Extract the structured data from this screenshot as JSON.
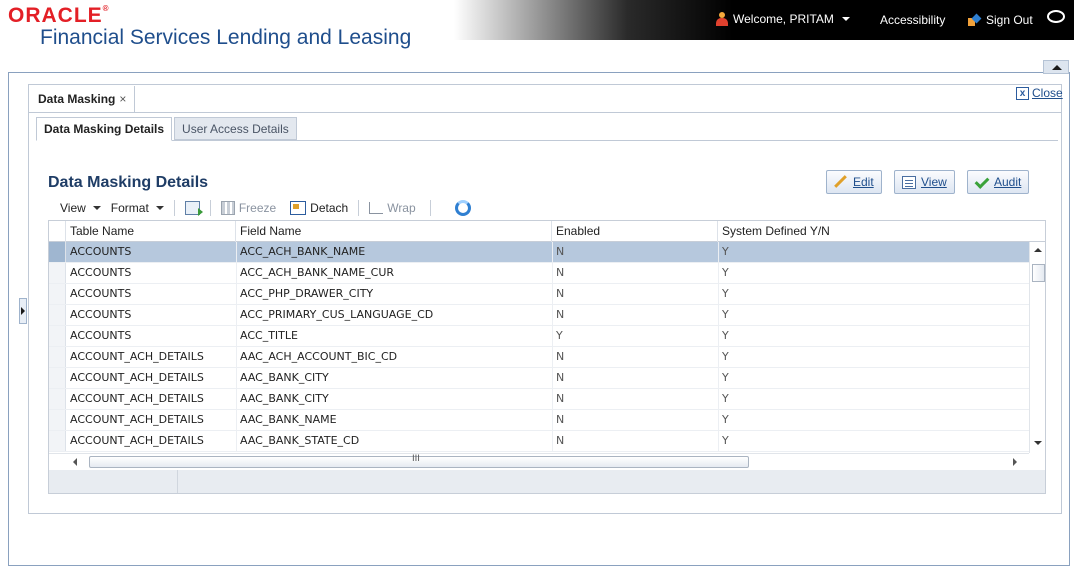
{
  "header": {
    "brand": "ORACLE",
    "brand_mark": "®",
    "product": "Financial Services Lending and Leasing",
    "welcome": "Welcome, PRITAM",
    "accessibility": "Accessibility",
    "sign_out": "Sign Out"
  },
  "page_tab": {
    "label": "Data Masking",
    "close_x": "×"
  },
  "close_link": {
    "label": "Close",
    "icon_glyph": "x"
  },
  "sub_tabs": [
    {
      "label": "Data Masking Details",
      "active": true
    },
    {
      "label": "User Access Details",
      "active": false
    }
  ],
  "section": {
    "title": "Data Masking Details",
    "actions": {
      "edit": "Edit",
      "view": "View",
      "audit": "Audit"
    }
  },
  "toolbar": {
    "view": "View",
    "format": "Format",
    "freeze": "Freeze",
    "detach": "Detach",
    "wrap": "Wrap"
  },
  "table": {
    "columns": [
      "Table Name",
      "Field Name",
      "Enabled",
      "System Defined Y/N"
    ],
    "rows": [
      [
        "ACCOUNTS",
        "ACC_ACH_BANK_NAME",
        "N",
        "Y"
      ],
      [
        "ACCOUNTS",
        "ACC_ACH_BANK_NAME_CUR",
        "N",
        "Y"
      ],
      [
        "ACCOUNTS",
        "ACC_PHP_DRAWER_CITY",
        "N",
        "Y"
      ],
      [
        "ACCOUNTS",
        "ACC_PRIMARY_CUS_LANGUAGE_CD",
        "N",
        "Y"
      ],
      [
        "ACCOUNTS",
        "ACC_TITLE",
        "Y",
        "Y"
      ],
      [
        "ACCOUNT_ACH_DETAILS",
        "AAC_ACH_ACCOUNT_BIC_CD",
        "N",
        "Y"
      ],
      [
        "ACCOUNT_ACH_DETAILS",
        "AAC_BANK_CITY",
        "N",
        "Y"
      ],
      [
        "ACCOUNT_ACH_DETAILS",
        "AAC_BANK_CITY",
        "N",
        "Y"
      ],
      [
        "ACCOUNT_ACH_DETAILS",
        "AAC_BANK_NAME",
        "N",
        "Y"
      ],
      [
        "ACCOUNT_ACH_DETAILS",
        "AAC_BANK_STATE_CD",
        "N",
        "Y"
      ]
    ],
    "selected_row": 0,
    "hscroll_grip": "III"
  },
  "colors": {
    "brand_red": "#e31f26",
    "title_blue": "#1f4e8c",
    "selected_row": "#b6c8dd"
  }
}
